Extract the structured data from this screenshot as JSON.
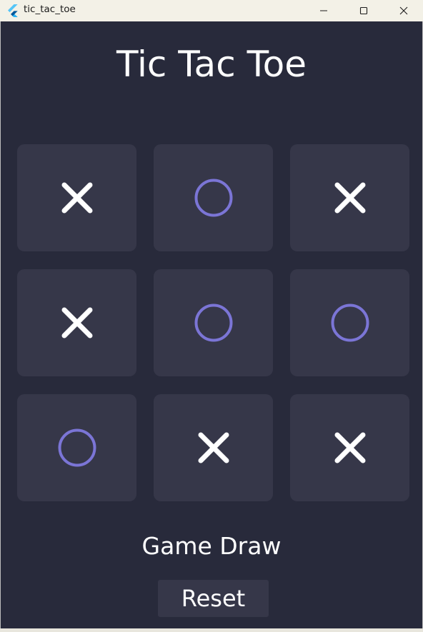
{
  "window": {
    "title": "tic_tac_toe",
    "controls": [
      "minimize-icon",
      "maximize-icon",
      "close-icon"
    ]
  },
  "app": {
    "title": "Tic Tac Toe",
    "status": "Game Draw",
    "reset_label": "Reset"
  },
  "board": {
    "cells": [
      "X",
      "O",
      "X",
      "X",
      "O",
      "O",
      "O",
      "X",
      "X"
    ]
  },
  "colors": {
    "background": "#282a3b",
    "cell": "#363749",
    "x_mark": "#ffffff",
    "o_mark": "#7b75d6",
    "text": "#ffffff"
  }
}
